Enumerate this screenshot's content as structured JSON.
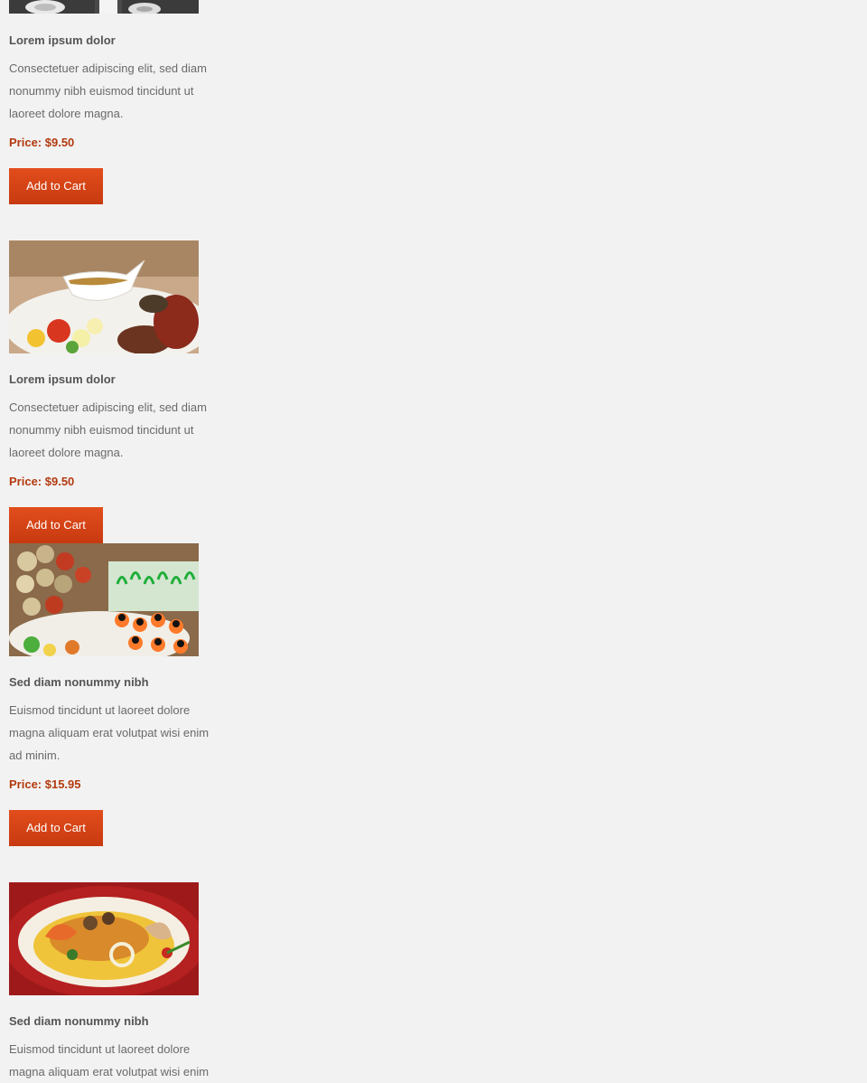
{
  "products": [
    {
      "image": "table-setting-image",
      "title": "Lorem ipsum dolor",
      "description": "Consectetuer adipiscing elit, sed diam nonummy nibh euismod tincidunt ut laoreet dolore magna.",
      "price": "Price: $9.50",
      "button": "Add to Cart"
    },
    {
      "image": "gravy-boat-meat-platter-image",
      "title": "Lorem ipsum dolor",
      "description": "Consectetuer adipiscing elit, sed diam nonummy nibh euismod tincidunt ut laoreet dolore magna.",
      "price": "Price: $9.50",
      "button": "Add to Cart"
    },
    {
      "image": "canapes-skewers-image",
      "title": "Sed diam nonummy nibh",
      "description": "Euismod tincidunt ut laoreet dolore magna aliquam erat volutpat wisi enim ad minim.",
      "price": "Price: $15.95",
      "button": "Add to Cart"
    },
    {
      "image": "seafood-plate-image",
      "title": "Sed diam nonummy nibh",
      "description": "Euismod tincidunt ut laoreet dolore magna aliquam erat volutpat wisi enim ad minim.",
      "price": "",
      "button": ""
    }
  ],
  "colors": {
    "background": "#f2f2f2",
    "accent": "#d94416",
    "price": "#b33a0e",
    "title": "#555555",
    "body_text": "#6a6a6a"
  }
}
